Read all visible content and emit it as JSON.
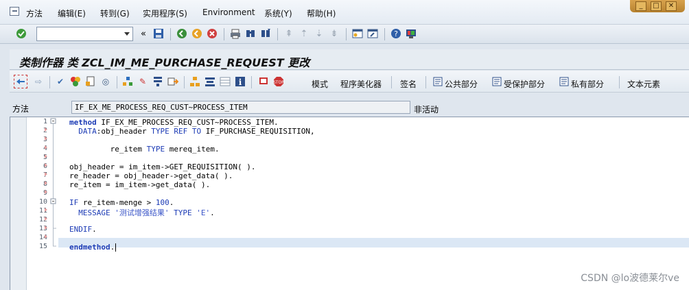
{
  "menu": {
    "items": [
      "方法",
      "编辑(E)",
      "转到(G)",
      "实用程序(S)",
      "Environment",
      "系统(Y)",
      "帮助(H)"
    ]
  },
  "window_controls": [
    "_",
    "□",
    "✕"
  ],
  "title": "类制作器 类 ZCL_IM_ME_PURCHASE_REQUEST 更改",
  "apptoolbar": {
    "mode_label": "模式",
    "pretty_printer_label": "程序美化器",
    "signature_label": "签名",
    "public_label": "公共部分",
    "protected_label": "受保护部分",
    "private_label": "私有部分",
    "text_elements_label": "文本元素"
  },
  "method": {
    "label": "方法",
    "value": "IF_EX_ME_PROCESS_REQ_CUST~PROCESS_ITEM",
    "status": "非活动"
  },
  "code": {
    "line_numbers": [
      "1",
      "2",
      "3",
      "4",
      "5",
      "6",
      "7",
      "8",
      "9",
      "10",
      "11",
      "12",
      "13",
      "14",
      "15"
    ],
    "lines": [
      "method IF_EX_ME_PROCESS_REQ_CUST~PROCESS_ITEM.",
      "  DATA:obj_header TYPE REF TO IF_PURCHASE_REQUISITION,",
      "",
      "         re_item TYPE mereq_item.",
      "",
      "obj_header = im_item->GET_REQUISITION( ).",
      "re_header = obj_header->get_data( ).",
      "re_item = im_item->get_data( ).",
      "",
      "IF re_item-menge > 100.",
      "  MESSAGE '测试增强结果' TYPE 'E'.",
      "",
      "ENDIF.",
      "",
      "endmethod."
    ]
  },
  "watermark": "CSDN @lo波德莱尔ve"
}
